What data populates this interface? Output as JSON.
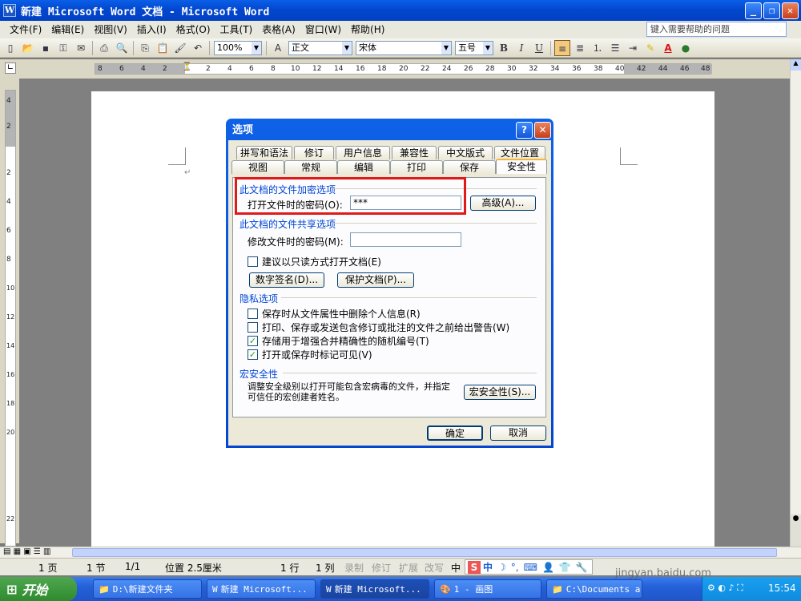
{
  "window": {
    "title": "新建 Microsoft Word 文档 - Microsoft Word"
  },
  "menu": {
    "items": [
      "文件(F)",
      "编辑(E)",
      "视图(V)",
      "插入(I)",
      "格式(O)",
      "工具(T)",
      "表格(A)",
      "窗口(W)",
      "帮助(H)"
    ],
    "help_placeholder": "键入需要帮助的问题"
  },
  "toolbar": {
    "zoom": "100%",
    "style": "正文",
    "font": "宋体",
    "size": "五号",
    "bold": "B",
    "italic": "I",
    "underline": "U",
    "font_color_label": "A"
  },
  "ruler": {
    "numbers": [
      "8",
      "6",
      "4",
      "2",
      "2",
      "4",
      "6",
      "8",
      "10",
      "12",
      "14",
      "16",
      "18",
      "20",
      "22",
      "24",
      "26",
      "28",
      "30",
      "32",
      "34",
      "36",
      "38",
      "40",
      "42",
      "44",
      "46",
      "48"
    ]
  },
  "vruler": {
    "numbers": [
      "4",
      "2",
      "2",
      "4",
      "6",
      "8",
      "10",
      "12",
      "14",
      "16",
      "18",
      "20",
      "22"
    ]
  },
  "dialog": {
    "title": "选项",
    "tabs_row1": [
      "拼写和语法",
      "修订",
      "用户信息",
      "兼容性",
      "中文版式",
      "文件位置"
    ],
    "tabs_row2": [
      "视图",
      "常规",
      "编辑",
      "打印",
      "保存",
      "安全性"
    ],
    "section_encrypt": "此文档的文件加密选项",
    "open_password_label": "打开文件时的密码(O):",
    "open_password_value": "***",
    "advanced_button": "高级(A)...",
    "section_share": "此文档的文件共享选项",
    "modify_password_label": "修改文件时的密码(M):",
    "modify_password_value": "",
    "readonly_label": "建议以只读方式打开文档(E)",
    "digital_sig_button": "数字签名(D)...",
    "protect_doc_button": "保护文档(P)...",
    "section_privacy": "隐私选项",
    "privacy": [
      {
        "label": "保存时从文件属性中删除个人信息(R)",
        "checked": false
      },
      {
        "label": "打印、保存或发送包含修订或批注的文件之前给出警告(W)",
        "checked": false
      },
      {
        "label": "存储用于增强合并精确性的随机编号(T)",
        "checked": true
      },
      {
        "label": "打开或保存时标记可见(V)",
        "checked": true
      }
    ],
    "section_macro": "宏安全性",
    "macro_text": "调整安全级别以打开可能包含宏病毒的文件，并指定可信任的宏创建者姓名。",
    "macro_button": "宏安全性(S)...",
    "ok_button": "确定",
    "cancel_button": "取消"
  },
  "status": {
    "page": "1 页",
    "section": "1 节",
    "pages": "1/1",
    "position": "位置 2.5厘米",
    "line": "1 行",
    "col": "1 列",
    "rec": "录制",
    "trk": "修订",
    "ext": "扩展",
    "ovr": "改写",
    "lang": "中"
  },
  "ime": {
    "label": "中"
  },
  "taskbar": {
    "start": "开始",
    "tasks": [
      "D:\\新建文件夹",
      "新建 Microsoft...",
      "新建 Microsoft...",
      "1 - 画图",
      "C:\\Documents a..."
    ],
    "clock": "15:54"
  },
  "watermark": {
    "brand": "Baidu经验",
    "url": "jingyan.baidu.com"
  }
}
